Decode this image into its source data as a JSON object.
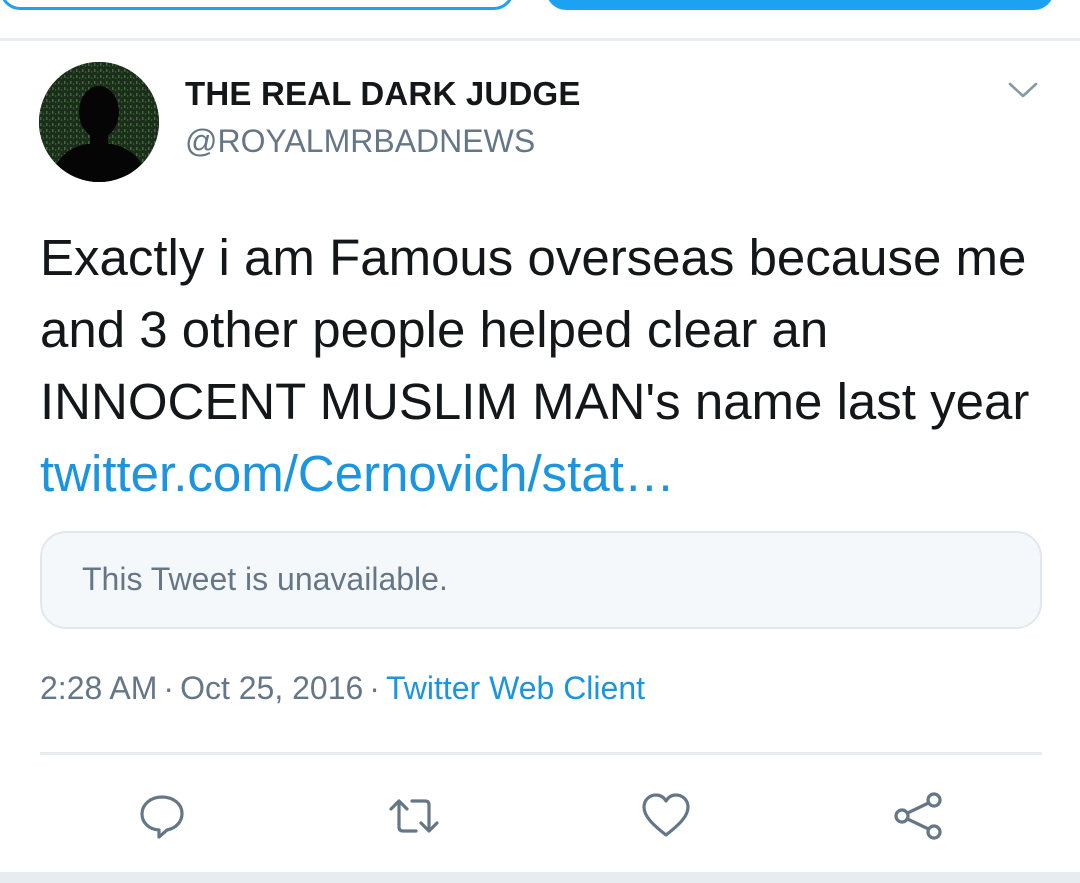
{
  "user": {
    "display_name": "THE REAL DARK JUDGE",
    "handle": "@ROYALMRBADNEWS"
  },
  "tweet": {
    "text": "Exactly i am Famous overseas because me and 3 other people helped clear an INNOCENT MUSLIM MAN's name last year",
    "link_text": "twitter.com/Cernovich/stat…"
  },
  "quoted_tweet": {
    "unavailable_text": "This Tweet is unavailable."
  },
  "meta": {
    "time": "2:28 AM",
    "date": "Oct 25, 2016",
    "separator": "·",
    "source": "Twitter Web Client"
  },
  "icons": {
    "menu": "chevron-down-icon",
    "reply": "reply-icon",
    "retweet": "retweet-icon",
    "like": "heart-icon",
    "share": "share-icon"
  },
  "colors": {
    "accent": "#1da1f2",
    "link": "#1b95e0",
    "secondary_text": "#657786",
    "primary_text": "#14171a",
    "divider": "#e6ecf0"
  }
}
